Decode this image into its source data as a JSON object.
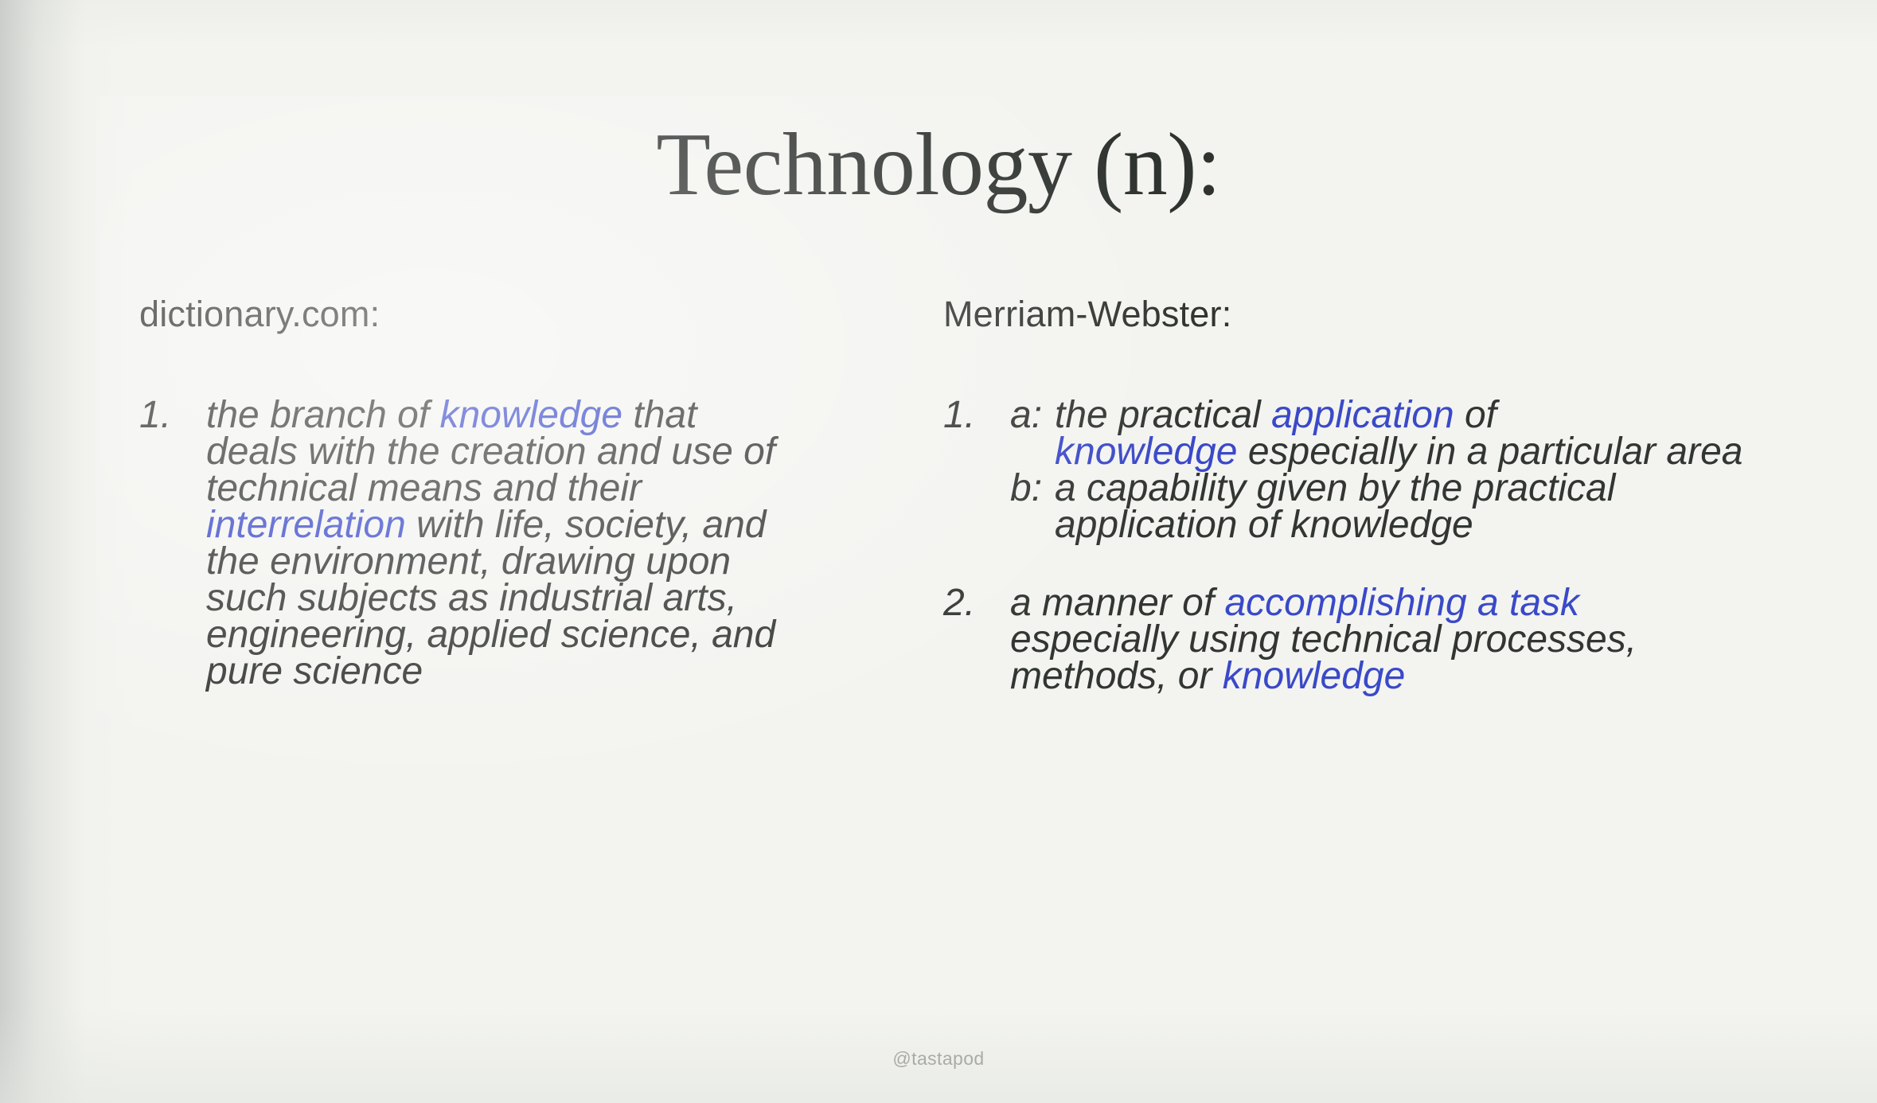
{
  "slide": {
    "title": "Technology (n):",
    "background_color": "#f3f4f0",
    "text_color": "#323633",
    "highlight_color": "#3a49c8",
    "footer_handle": "@tastapod"
  },
  "columns": [
    {
      "id": "dictionary-com",
      "heading": "dictionary.com:",
      "entries": [
        {
          "marker": "1.",
          "lines": [
            [
              {
                "text": "the branch of ",
                "style": "plain"
              },
              {
                "text": "knowledge",
                "style": "highlight"
              },
              {
                "text": " that",
                "style": "plain"
              }
            ],
            [
              {
                "text": "deals with the creation and use of",
                "style": "plain"
              }
            ],
            [
              {
                "text": "technical means and their",
                "style": "plain"
              }
            ],
            [
              {
                "text": "interrelation",
                "style": "highlight"
              },
              {
                "text": " with life, society, and",
                "style": "plain"
              }
            ],
            [
              {
                "text": "the environment, drawing upon",
                "style": "plain"
              }
            ],
            [
              {
                "text": "such subjects as industrial arts,",
                "style": "plain"
              }
            ],
            [
              {
                "text": "engineering, applied science, and",
                "style": "plain"
              }
            ],
            [
              {
                "text": "pure science",
                "style": "plain"
              }
            ]
          ]
        }
      ]
    },
    {
      "id": "merriam-webster",
      "heading": "Merriam-Webster:",
      "entries": [
        {
          "marker": "1.",
          "lines": [
            [
              {
                "text": "a:",
                "style": "plain",
                "role": "sublabel"
              },
              {
                "text": "the practical ",
                "style": "plain"
              },
              {
                "text": "application",
                "style": "highlight"
              },
              {
                "text": " of",
                "style": "plain"
              }
            ],
            [
              {
                "text": "knowledge",
                "style": "highlight"
              },
              {
                "text": " especially in a particular area",
                "style": "plain"
              }
            ],
            [
              {
                "text": "b:",
                "style": "plain",
                "role": "sublabel"
              },
              {
                "text": "a capability given by the practical",
                "style": "plain"
              }
            ],
            [
              {
                "text": "application of knowledge",
                "style": "plain"
              }
            ]
          ]
        },
        {
          "marker": "2.",
          "lines": [
            [
              {
                "text": "a manner of ",
                "style": "plain"
              },
              {
                "text": "accomplishing a task",
                "style": "highlight"
              }
            ],
            [
              {
                "text": "especially using technical processes,",
                "style": "plain"
              }
            ],
            [
              {
                "text": "methods, or ",
                "style": "plain"
              },
              {
                "text": "knowledge",
                "style": "highlight"
              }
            ]
          ]
        }
      ]
    }
  ]
}
